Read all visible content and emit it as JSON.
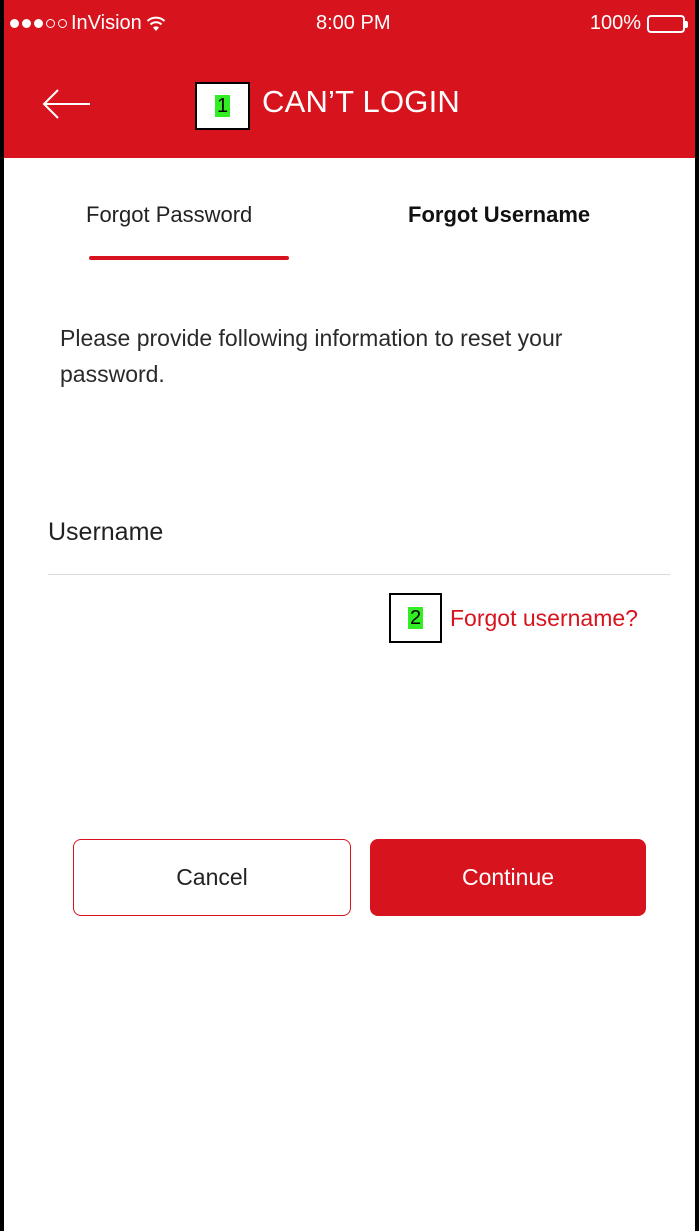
{
  "status_bar": {
    "carrier": "InVision",
    "time": "8:00 PM",
    "battery": "100%",
    "signal_icon": "signal-dots-icon",
    "wifi_icon": "wifi-icon",
    "battery_icon": "battery-icon"
  },
  "header": {
    "title": "CAN’T LOGIN",
    "back_icon": "arrow-left-icon",
    "background_color": "#d7141e"
  },
  "annotations": {
    "marker_1": "1",
    "marker_2": "2"
  },
  "tabs": [
    {
      "label": "Forgot Password",
      "active": true
    },
    {
      "label": "Forgot Username",
      "active": false
    }
  ],
  "form": {
    "instructions": "Please provide following information to reset your password.",
    "username_placeholder": "Username",
    "username_value": "",
    "forgot_username_link": "Forgot username?"
  },
  "buttons": {
    "cancel": "Cancel",
    "continue": "Continue"
  }
}
